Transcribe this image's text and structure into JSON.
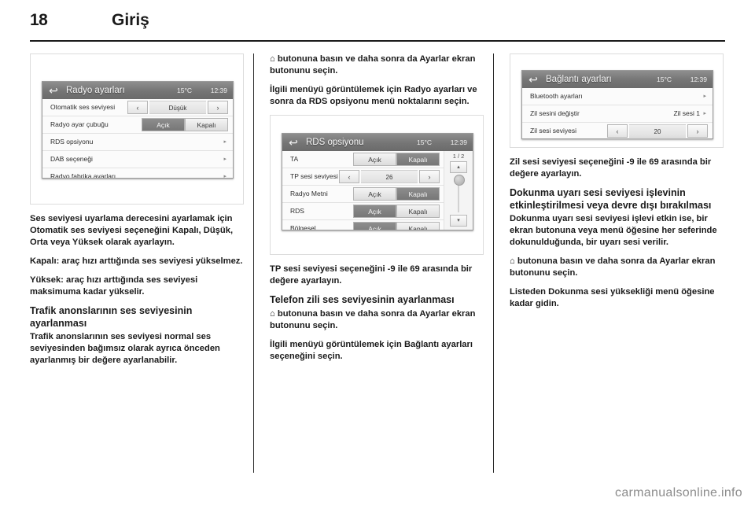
{
  "document": {
    "page_number": "18",
    "chapter_title": "Giriş",
    "footer_watermark": "carmanualsonline.info"
  },
  "screens": {
    "radio_settings": {
      "back_icon": "back-arrow-icon",
      "title": "Radyo ayarları",
      "temperature": "15°C",
      "time": "12:39",
      "rows": [
        {
          "label": "Otomatik ses seviyesi",
          "type": "stepper",
          "prev": "‹",
          "value": "Düşük",
          "next": "›"
        },
        {
          "label": "Radyo ayar çubuğu",
          "type": "segmented",
          "on_label": "Açık",
          "off_label": "Kapalı",
          "selected": "Açık"
        },
        {
          "label": "RDS opsiyonu",
          "type": "submenu",
          "chevron": "▸"
        },
        {
          "label": "DAB seçeneği",
          "type": "submenu",
          "chevron": "▸"
        },
        {
          "label": "Radyo fabrika ayarları",
          "type": "submenu",
          "chevron": "▸"
        }
      ]
    },
    "rds_options": {
      "back_icon": "back-arrow-icon",
      "title": "RDS opsiyonu",
      "temperature": "15°C",
      "time": "12:39",
      "page_indicator": "1 / 2",
      "scroll_up": "▴",
      "scroll_down": "▾",
      "rows": [
        {
          "label": "TA",
          "type": "segmented",
          "on_label": "Açık",
          "off_label": "Kapalı",
          "selected": "Kapalı"
        },
        {
          "label": "TP sesi seviyesi",
          "type": "stepper",
          "prev": "‹",
          "value": "26",
          "next": "›"
        },
        {
          "label": "Radyo Metni",
          "type": "segmented",
          "on_label": "Açık",
          "off_label": "Kapalı",
          "selected": "Kapalı"
        },
        {
          "label": "RDS",
          "type": "segmented",
          "on_label": "Açık",
          "off_label": "Kapalı",
          "selected": "Açık"
        },
        {
          "label": "Bölgesel",
          "type": "segmented",
          "on_label": "Açık",
          "off_label": "Kapalı",
          "selected": "Açık"
        }
      ]
    },
    "connection_settings": {
      "back_icon": "back-arrow-icon",
      "title": "Bağlantı ayarları",
      "temperature": "15°C",
      "time": "12:39",
      "rows": [
        {
          "label": "Bluetooth ayarları",
          "type": "submenu",
          "chevron": "▸"
        },
        {
          "label": "Zil sesini değiştir",
          "type": "value",
          "value": "Zil sesi 1",
          "chevron": "▸"
        },
        {
          "label": "Zil sesi seviyesi",
          "type": "stepper",
          "prev": "‹",
          "value": "20",
          "next": "›"
        }
      ]
    }
  },
  "columns": {
    "left": {
      "paragraphs": [
        "Ses seviyesi uyarlama derecesini ayarlamak için Otomatik ses seviyesi seçeneğini Kapalı, Düşük, Orta veya Yüksek olarak ayarlayın.",
        "Kapalı: araç hızı arttığında ses seviyesi yükselmez.",
        "Yüksek: araç hızı arttığında ses seviyesi maksimuma kadar yükselir."
      ],
      "heading": "Trafik anonslarının ses seviyesinin ayarlanması",
      "after_heading": "Trafik anonslarının ses seviyesi normal ses seviyesinden bağımsız olarak ayrıca önceden ayarlanmış bir değere ayarlanabilir."
    },
    "middle": {
      "top_paragraphs": [
        "⌂ butonuna basın ve daha sonra da Ayarlar ekran butonunu seçin.",
        "İlgili menüyü görüntülemek için Radyo ayarları ve sonra da RDS opsiyonu menü noktalarını seçin."
      ],
      "bottom_paragraphs": [
        "TP sesi seviyesi  seçeneğini -9 ile 69 arasında bir değere ayarlayın."
      ],
      "heading": "Telefon zili ses seviyesinin ayarlanması",
      "after_heading": [
        "⌂ butonuna basın ve daha sonra da Ayarlar ekran butonunu seçin.",
        "İlgili menüyü görüntülemek için Bağlantı ayarları seçeneğini seçin."
      ]
    },
    "right": {
      "top_paragraphs": [
        "Zil sesi seviyesi seçeneğini -9 ile 69 arasında bir değere ayarlayın."
      ],
      "heading": "Dokunma uyarı sesi seviyesi işlevinin etkinleştirilmesi veya devre dışı bırakılması",
      "after_heading": [
        "Dokunma uyarı sesi seviyesi işlevi etkin ise, bir ekran butonuna veya menü öğesine her seferinde dokunulduğunda, bir uyarı sesi verilir.",
        "⌂ butonuna basın ve daha sonra da Ayarlar ekran butonunu seçin.",
        "Listeden Dokunma sesi yüksekliği menü öğesine kadar gidin."
      ]
    }
  }
}
